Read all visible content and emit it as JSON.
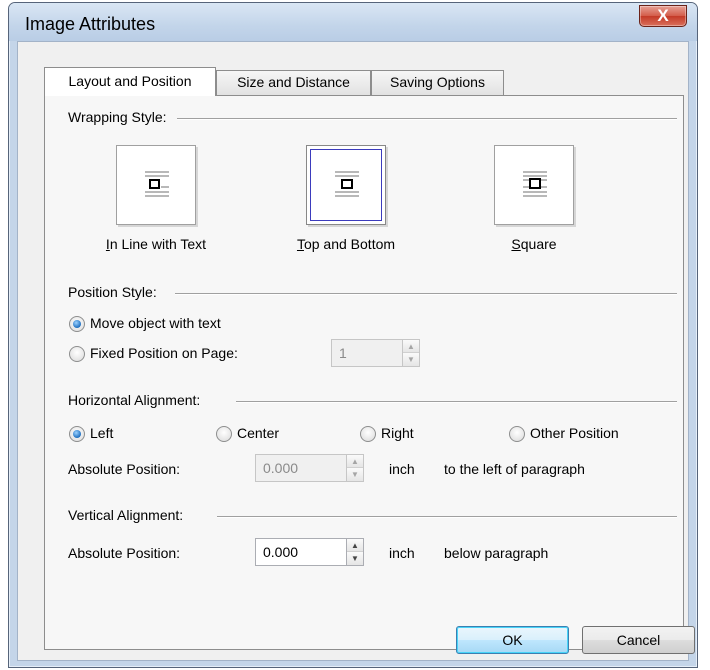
{
  "window": {
    "title": "Image Attributes",
    "close_symbol": "X"
  },
  "tabs": [
    {
      "label": "Layout and Position",
      "active": true
    },
    {
      "label": "Size and Distance",
      "active": false
    },
    {
      "label": "Saving Options",
      "active": false
    }
  ],
  "wrapping": {
    "group_label": "Wrapping Style:",
    "options": [
      {
        "label": "In Line with Text",
        "mnemonic": "I",
        "selected": false
      },
      {
        "label": "Top and Bottom",
        "mnemonic": "T",
        "selected": true
      },
      {
        "label": "Square",
        "mnemonic": "S",
        "selected": false
      }
    ]
  },
  "position_style": {
    "group_label": "Position Style:",
    "move_with_text": "Move object with text",
    "fixed_position": "Fixed Position on Page:",
    "page_value": "1"
  },
  "horizontal": {
    "group_label": "Horizontal Alignment:",
    "options": [
      "Left",
      "Center",
      "Right",
      "Other Position"
    ],
    "absolute_label": "Absolute Position:",
    "absolute_value": "0.000",
    "unit": "inch",
    "relation": "to the left of paragraph"
  },
  "vertical": {
    "group_label": "Vertical Alignment:",
    "absolute_label": "Absolute Position:",
    "absolute_value": "0.000",
    "unit": "inch",
    "relation": "below paragraph"
  },
  "footer": {
    "ok_label": "OK",
    "cancel_label": "Cancel"
  },
  "colors": {
    "accent": "#1f6fbf",
    "frame": "#c4d5e9",
    "close": "#c43a27"
  }
}
